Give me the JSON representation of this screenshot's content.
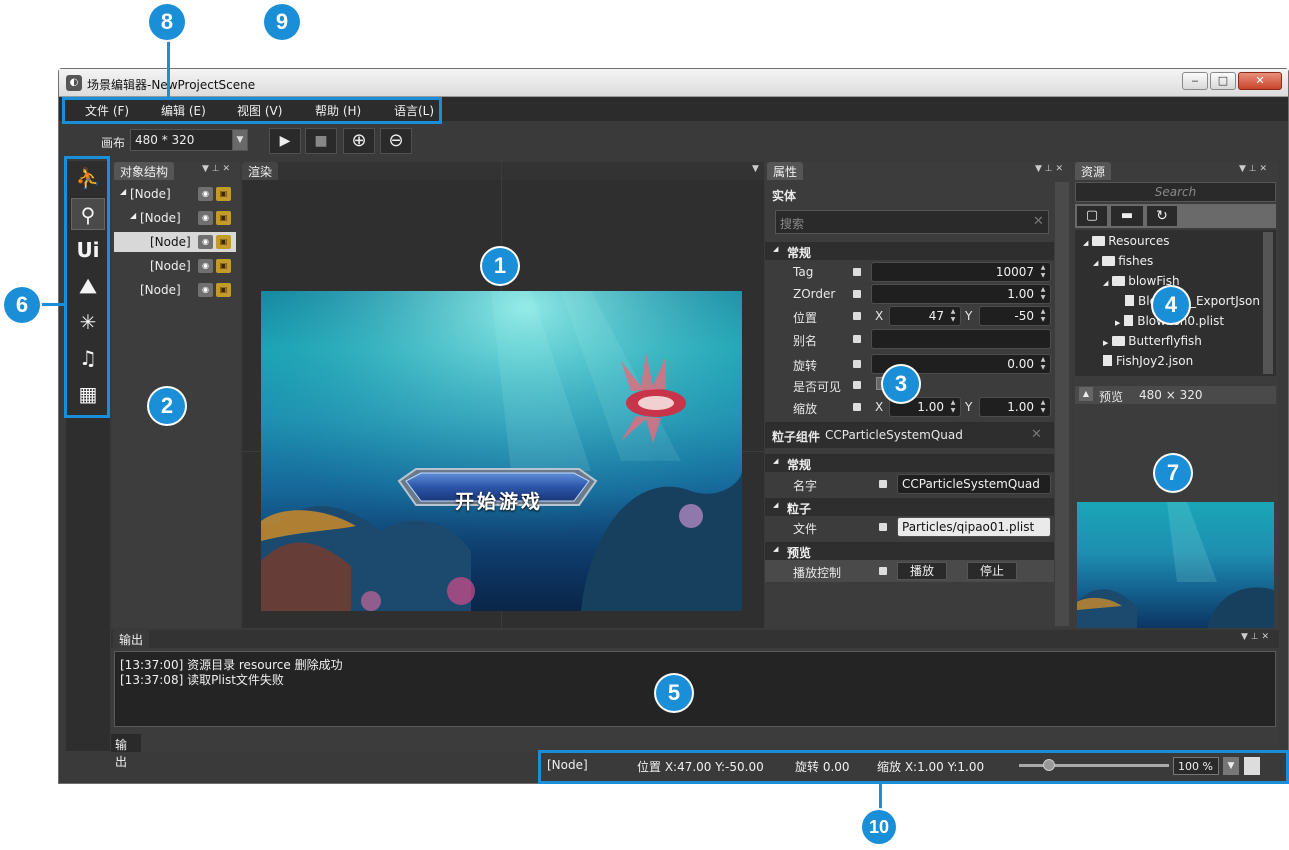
{
  "window": {
    "title": "场景编辑器-NewProjectScene",
    "controls": {
      "minimize": "‒",
      "maximize": "□",
      "close": "✕"
    }
  },
  "menu": [
    "文件 (F)",
    "编辑 (E)",
    "视图 (V)",
    "帮助 (H)",
    "语言(L)"
  ],
  "toolbar": {
    "canvas_label": "画布",
    "canvas_size": "480 * 320",
    "buttons": [
      {
        "name": "play-icon",
        "glyph": "▶"
      },
      {
        "name": "stop-icon",
        "glyph": "■"
      },
      {
        "name": "zoom-in-icon",
        "glyph": "⊕"
      },
      {
        "name": "zoom-out-icon",
        "glyph": "⊖"
      }
    ]
  },
  "toolstrip": [
    {
      "name": "scene-objects-tool-icon",
      "glyph": "⛹"
    },
    {
      "name": "bone-animation-tool-icon",
      "glyph": "⚲"
    },
    {
      "name": "ui-tool-icon",
      "glyph": "Ui"
    },
    {
      "name": "map-tool-icon",
      "glyph": "⛰"
    },
    {
      "name": "particle-tool-icon",
      "glyph": "✳"
    },
    {
      "name": "audio-tool-icon",
      "glyph": "♫"
    },
    {
      "name": "controls-tool-icon",
      "glyph": "▦"
    }
  ],
  "object_tree": {
    "title": "对象结构",
    "nodes": [
      "[Node]",
      "[Node]",
      "[Node]",
      "[Node]",
      "[Node]"
    ]
  },
  "render": {
    "title": "渲染",
    "button_text": "开始游戏"
  },
  "properties": {
    "title": "属性",
    "entity": "实体",
    "search_placeholder": "搜索",
    "section_general": "常规",
    "tag_label": "Tag",
    "tag_value": "10007",
    "zorder_label": "ZOrder",
    "zorder_value": "1.00",
    "position_label": "位置",
    "x_label": "X",
    "y_label": "Y",
    "pos_x": "47",
    "pos_y": "-50",
    "alias_label": "别名",
    "alias_value": "",
    "rotation_label": "旋转",
    "rotation_value": "0.00",
    "visible_label": "是否可见",
    "scale_label": "缩放",
    "scale_x": "1.00",
    "scale_y": "1.00",
    "particle_component_label": "粒子组件",
    "particle_component_value": "CCParticleSystemQuad",
    "section_general2": "常规",
    "name_label": "名字",
    "name_value": "CCParticleSystemQuad",
    "section_particle": "粒子",
    "file_label": "文件",
    "file_value": "Particles/qipao01.plist",
    "section_preview": "预览",
    "playback_label": "播放控制",
    "play_button": "播放",
    "stop_button": "停止"
  },
  "resources": {
    "title": "资源",
    "search_placeholder": "Search",
    "tree": [
      {
        "label": "Resources",
        "type": "folder",
        "arrow": "◢"
      },
      {
        "label": "fishes",
        "type": "folder",
        "arrow": "◢"
      },
      {
        "label": "blowFish",
        "type": "folder",
        "arrow": "◢"
      },
      {
        "label": "BlowFish_ExportJson",
        "type": "file",
        "arrow": ""
      },
      {
        "label": "Blowfish0.plist",
        "type": "file",
        "arrow": "▶"
      },
      {
        "label": "Butterflyfish",
        "type": "folder",
        "arrow": "▶"
      },
      {
        "label": "FishJoy2.json",
        "type": "file",
        "arrow": ""
      }
    ],
    "preview_label": "预览",
    "preview_size": "480 × 320"
  },
  "output": {
    "title": "输出",
    "tab": "输出",
    "lines": [
      "[13:37:00]  资源目录 resource 删除成功",
      "[13:37:08]  读取Plist文件失败"
    ]
  },
  "status": {
    "node": "[Node]",
    "position": "位置  X:47.00   Y:-50.00",
    "rotation": "旋转  0.00",
    "scale": "缩放  X:1.00   Y:1.00",
    "zoom": "100 %",
    "zoom_level": 0.2
  },
  "callouts": [
    "1",
    "2",
    "3",
    "4",
    "5",
    "6",
    "7",
    "8",
    "9",
    "10"
  ],
  "colors": {
    "callout": "#1a8fd8",
    "panel": "#3c3c3c",
    "background": "#2f2f2f"
  }
}
